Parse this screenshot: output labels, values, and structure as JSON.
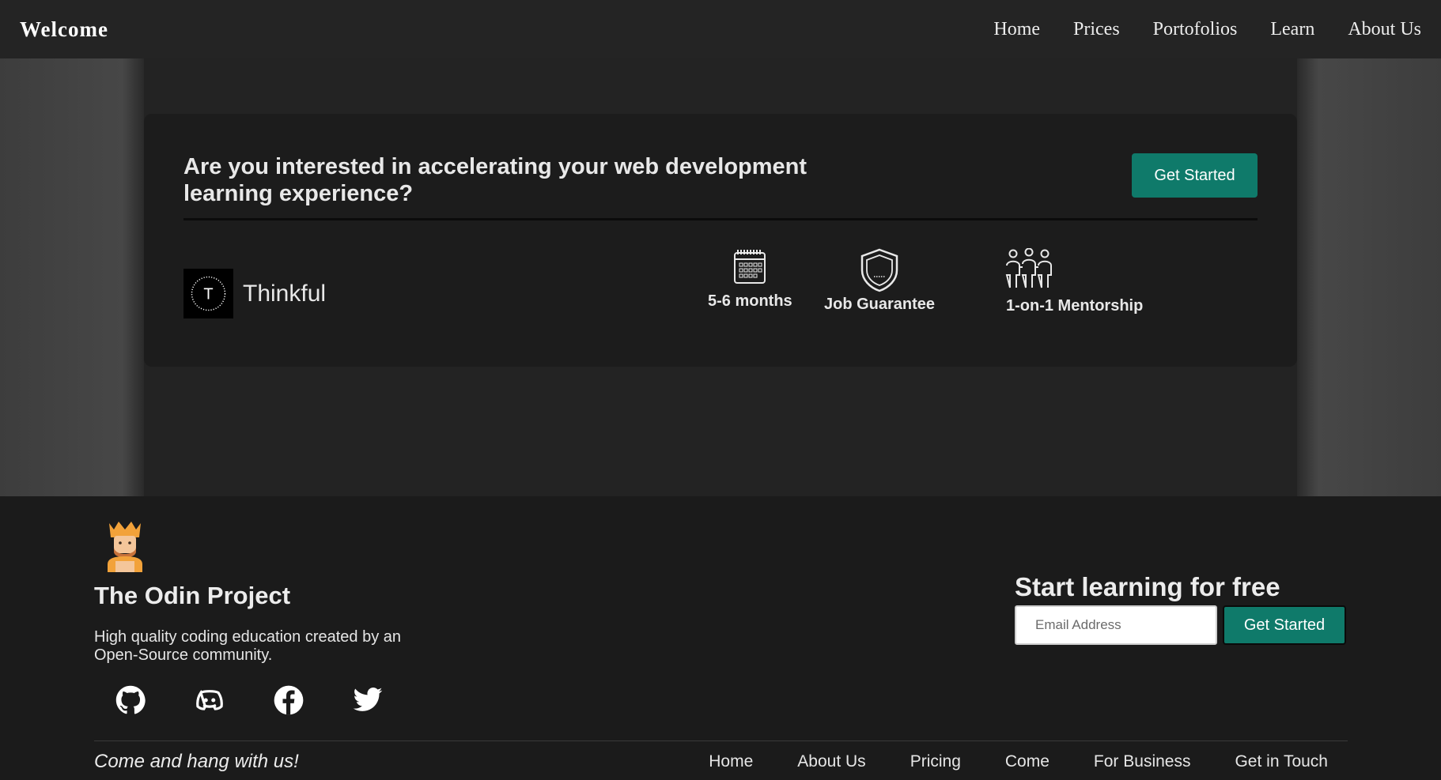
{
  "header": {
    "brand": "Welcome",
    "nav": [
      "Home",
      "Prices",
      "Portofolios",
      "Learn",
      "About Us"
    ]
  },
  "card": {
    "title": "Are you interested in accelerating your web development learning experience?",
    "cta_label": "Get Started",
    "provider": {
      "logo_letter": "T",
      "name": "Thinkful"
    },
    "features": [
      {
        "icon": "calendar-icon",
        "label": "5-6 months"
      },
      {
        "icon": "shield-icon",
        "label": "Job Guarantee"
      },
      {
        "icon": "mentorship-icon",
        "label": "1-on-1 Mentorship"
      }
    ]
  },
  "footer": {
    "title": "The Odin Project",
    "description": "High quality coding education created by an Open-Source community.",
    "socials": [
      "github-icon",
      "discord-icon",
      "facebook-icon",
      "twitter-icon"
    ],
    "signup": {
      "title": "Start learning for free",
      "email_placeholder": "Email Address",
      "button_label": "Get Started"
    },
    "tagline": "Come and hang with us!",
    "nav": [
      "Home",
      "About Us",
      "Pricing",
      "Come",
      "For Business",
      "Get in Touch"
    ]
  },
  "colors": {
    "accent": "#0f7a6a",
    "background": "#242424",
    "footer": "#1b1b1b",
    "card": "#1c1c1c"
  }
}
